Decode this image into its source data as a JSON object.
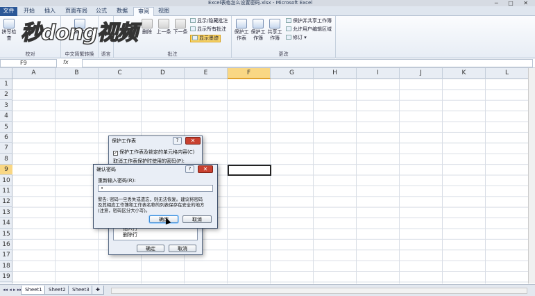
{
  "window": {
    "title": "Excel表格怎么设置密码.xlsx - Microsoft Excel"
  },
  "tabs": [
    {
      "label": "文件"
    },
    {
      "label": "开始"
    },
    {
      "label": "插入"
    },
    {
      "label": "页面布局"
    },
    {
      "label": "公式"
    },
    {
      "label": "数据"
    },
    {
      "label": "审阅"
    },
    {
      "label": "视图"
    }
  ],
  "ribbon": {
    "groups": {
      "proofing": "校对",
      "chinese": "中文简繁转换",
      "language": "语言",
      "comments": "批注",
      "changes": "更改"
    },
    "chinese_btn": "繁简转换",
    "proof_btn": "拼写检查",
    "comment_btns": {
      "delete": "删除",
      "prev": "上一条",
      "next": "下一条"
    },
    "comment_small": {
      "show_hide": "显示/隐藏批注",
      "show_all": "显示所有批注",
      "show_ink": "显示墨迹"
    },
    "change_btns": {
      "protect_sheet": "保护工作表",
      "protect_workbook": "保护工作簿",
      "share_workbook": "共享工作簿"
    },
    "change_small": {
      "protect_share": "保护并共享工作簿",
      "allow_edit": "允许用户编辑区域",
      "track": "修订"
    }
  },
  "watermark": "秒dong视频",
  "formula_bar": {
    "name_box": "F9",
    "fx": "fx",
    "value": ""
  },
  "columns": [
    "A",
    "B",
    "C",
    "D",
    "E",
    "F",
    "G",
    "H",
    "I",
    "J",
    "K",
    "L"
  ],
  "rows": [
    "1",
    "2",
    "3",
    "4",
    "5",
    "6",
    "7",
    "8",
    "9",
    "10",
    "11",
    "12",
    "13",
    "14",
    "15",
    "16",
    "17",
    "18",
    "19"
  ],
  "sheets": [
    "Sheet1",
    "Sheet2",
    "Sheet3"
  ],
  "protect_dialog": {
    "title": "保护工作表",
    "help": "?",
    "checkbox_label": "保护工作表及锁定的单元格内容(C)",
    "password_label": "取消工作表保护时使用的密码(P):",
    "list_items": [
      "插入行",
      "删除行"
    ],
    "ok": "确定",
    "cancel": "取消"
  },
  "confirm_dialog": {
    "title": "确认密码",
    "help": "?",
    "close": "✕",
    "reenter_label": "重新输入密码(R):",
    "password_value": "•",
    "warning_line1": "警告: 密码一旦丢失或遗忘，则无法恢复。建议将密码",
    "warning_line2": "及其相应工作簿和工作表名称的列表保存在安全的地方",
    "warning_line3": "(注意，密码区分大小写)。",
    "ok": "确定",
    "cancel": "取消"
  },
  "colors": {
    "accent": "#2b5797",
    "selection": "#f9d784",
    "close": "#c8402f"
  }
}
